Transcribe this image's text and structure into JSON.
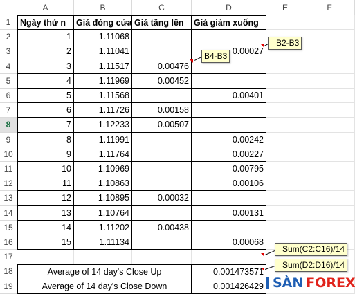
{
  "columns": [
    "",
    "A",
    "B",
    "C",
    "D",
    "E",
    "F"
  ],
  "selected_row": 8,
  "headers": [
    "Ngày thứ n",
    "Giá đóng cửa",
    "Giá tăng lên",
    "Giá giảm xuống"
  ],
  "rows": [
    {
      "n": "1",
      "close": "1.11068",
      "up": "",
      "down": ""
    },
    {
      "n": "2",
      "close": "1.11041",
      "up": "",
      "down": "0.00027"
    },
    {
      "n": "3",
      "close": "1.11517",
      "up": "0.00476",
      "down": ""
    },
    {
      "n": "4",
      "close": "1.11969",
      "up": "0.00452",
      "down": ""
    },
    {
      "n": "5",
      "close": "1.11568",
      "up": "",
      "down": "0.00401"
    },
    {
      "n": "6",
      "close": "1.11726",
      "up": "0.00158",
      "down": ""
    },
    {
      "n": "7",
      "close": "1.12233",
      "up": "0.00507",
      "down": ""
    },
    {
      "n": "8",
      "close": "1.11991",
      "up": "",
      "down": "0.00242"
    },
    {
      "n": "9",
      "close": "1.11764",
      "up": "",
      "down": "0.00227"
    },
    {
      "n": "10",
      "close": "1.10969",
      "up": "",
      "down": "0.00795"
    },
    {
      "n": "11",
      "close": "1.10863",
      "up": "",
      "down": "0.00106"
    },
    {
      "n": "12",
      "close": "1.10895",
      "up": "0.00032",
      "down": ""
    },
    {
      "n": "13",
      "close": "1.10764",
      "up": "",
      "down": "0.00131"
    },
    {
      "n": "14",
      "close": "1.11202",
      "up": "0.00438",
      "down": ""
    },
    {
      "n": "15",
      "close": "1.11134",
      "up": "",
      "down": "0.00068"
    }
  ],
  "summary": [
    {
      "label": "Average of 14 day's Close Up",
      "value": "0.001473571"
    },
    {
      "label": "Average of 14 day's Close Down",
      "value": "0.001426429"
    }
  ],
  "callouts": {
    "b2b3": "=B2-B3",
    "b4b3": "B4-B3",
    "sum_up": "=Sum(C2:C16)/14",
    "sum_down": "=Sum(D2:D16)/14"
  },
  "logo": {
    "san": "SÀN",
    "forex": "FOREX"
  },
  "colors": {
    "callout_bg": "#ffffcc",
    "comment_marker": "#e00000",
    "logo_blue": "#1f5fb4",
    "logo_red": "#e0231b"
  }
}
